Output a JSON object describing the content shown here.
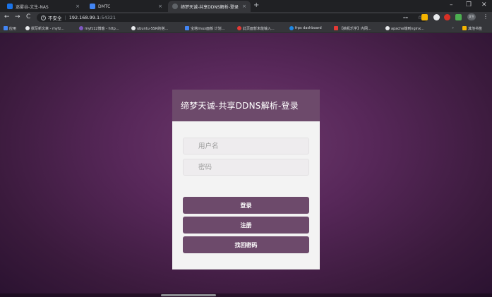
{
  "tabs": [
    {
      "title": "迷雾谷-文生-NAS",
      "icon_color": "#1a73e8"
    },
    {
      "title": "DMTC",
      "icon_color": "#4285f4"
    },
    {
      "title": "缔梦天诚-共享DDNS解析-登录",
      "icon_color": "#5f6368"
    }
  ],
  "tab_close_glyph": "×",
  "new_tab_glyph": "+",
  "window_controls": {
    "minimize": "–",
    "maximize": "❐",
    "close": "✕"
  },
  "nav": {
    "back": "←",
    "forward": "→",
    "reload": "C"
  },
  "address": {
    "security_label": "不安全",
    "host": "192.168.99.1",
    "port": ":54321",
    "info_glyph": "i",
    "key_glyph": "⊶",
    "star_glyph": "☆"
  },
  "profile_label": "文生",
  "menu_glyph": "⋮",
  "bookmarks": [
    {
      "label": "应用",
      "icon": "apps-icon",
      "color": "#4285f4"
    },
    {
      "label": "撰写新文章 - myfz...",
      "icon": "globe-icon",
      "color": "#e8eaed"
    },
    {
      "label": "myfz12博客 - http...",
      "icon": "blog-icon",
      "color": "#7e57c2"
    },
    {
      "label": "ubuntu-SSR的搭...",
      "icon": "globe-icon",
      "color": "#e8eaed"
    },
    {
      "label": "宝塔linux面板 计划...",
      "icon": "panel-icon",
      "color": "#4285f4"
    },
    {
      "label": "此页面暂未能输入...",
      "icon": "p-icon",
      "color": "#e53935"
    },
    {
      "label": "frps dashboard",
      "icon": "frp-icon",
      "color": "#1e88e5"
    },
    {
      "label": "【搞机乐学】内网...",
      "icon": "blog-icon",
      "color": "#e53935"
    },
    {
      "label": "apache端到nginx...",
      "icon": "globe-icon",
      "color": "#e8eaed"
    }
  ],
  "bookmarks_more": "»",
  "bookmarks_other": {
    "label": "其他书签",
    "color": "#f5b400"
  },
  "login": {
    "title": "缔梦天诚-共享DDNS解析-登录",
    "username_placeholder": "用户名",
    "password_placeholder": "密码",
    "login_button": "登录",
    "register_button": "注册",
    "recover_button": "找回密码"
  },
  "colors": {
    "accent": "#6d4a6b",
    "background": "#58285a",
    "card": "#f3f3f3"
  }
}
